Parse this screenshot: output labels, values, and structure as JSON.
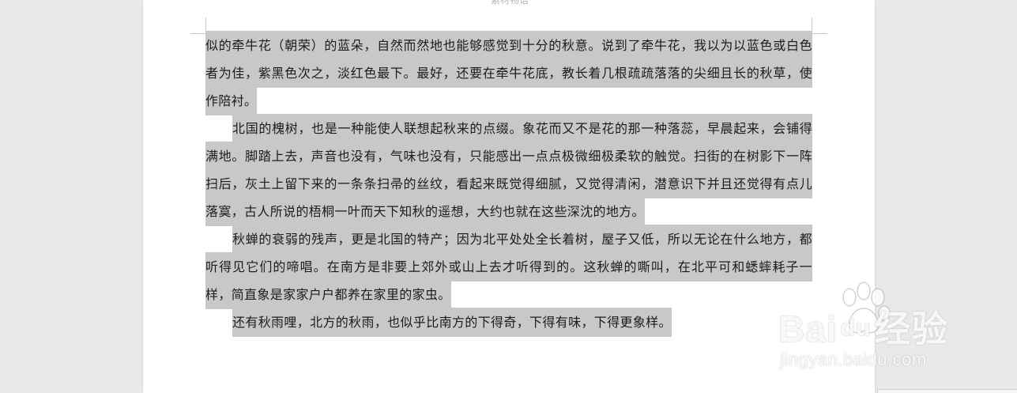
{
  "document": {
    "header_text": "素材物语",
    "paragraphs": [
      {
        "text": "似的牵牛花（朝荣）的蓝朵，自然而然地也能够感觉到十分的秋意。说到了牵牛花，我以为以蓝色或白色者为佳，紫黑色次之，淡红色最下。最好，还要在牵牛花底，教长着几根疏疏落落的尖细且长的秋草，使作陪衬。",
        "indent": false
      },
      {
        "text": "北国的槐树，也是一种能使人联想起秋来的点缀。象花而又不是花的那一种落蕊，早晨起来，会铺得满地。脚踏上去，声音也没有，气味也没有，只能感出一点点极微细极柔软的触觉。扫街的在树影下一阵扫后，灰土上留下来的一条条扫帚的丝纹，看起来既觉得细腻，又觉得清闲，潜意识下并且还觉得有点儿落寞，古人所说的梧桐一叶而天下知秋的遥想，大约也就在这些深沈的地方。",
        "indent": true
      },
      {
        "text": "秋蝉的衰弱的残声，更是北国的特产；因为北平处处全长着树，屋子又低，所以无论在什么地方，都听得见它们的啼唱。在南方是非要上郊外或山上去才听得到的。这秋蝉的嘶叫，在北平可和蟋蟀耗子一样，简直象是家家户户都养在家里的家虫。",
        "indent": true
      },
      {
        "text": "还有秋雨哩，北方的秋雨，也似乎比南方的下得奇，下得有味，下得更象样。",
        "indent": true
      }
    ]
  },
  "watermark": {
    "brand_left": "Bai",
    "brand_du": "du",
    "brand_right": "经验",
    "url": "jingyan.baidu.com"
  },
  "colors": {
    "selection": "#c8c8c8",
    "background": "#e9e9e9",
    "page": "#ffffff"
  }
}
